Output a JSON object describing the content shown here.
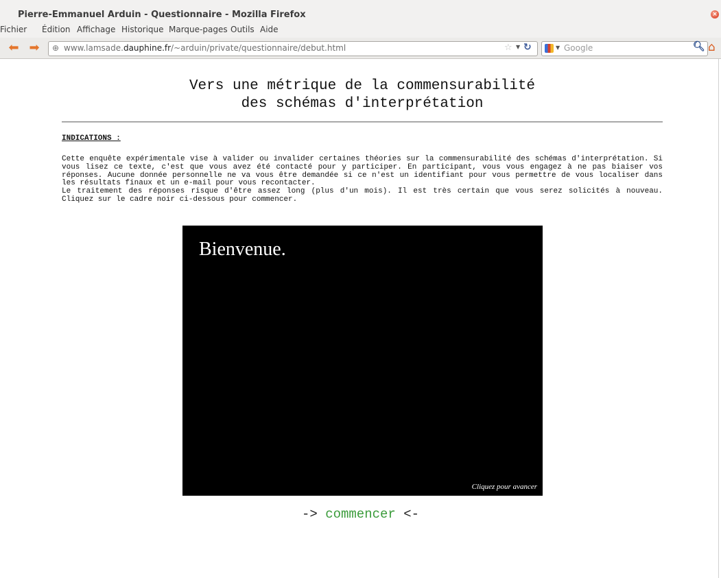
{
  "window": {
    "title": "Pierre-Emmanuel Arduin - Questionnaire - Mozilla Firefox"
  },
  "menu": [
    "Fichier",
    "Édition",
    "Affichage",
    "Historique",
    "Marque-pages",
    "Outils",
    "Aide"
  ],
  "navbar": {
    "url_prefix": "www.lamsade.",
    "url_domain": "dauphine.fr",
    "url_suffix": "/~arduin/private/questionnaire/debut.html",
    "search_engine": "Google"
  },
  "page": {
    "title_line1": "Vers une métrique de la commensurabilité",
    "title_line2": "des schémas d'interprétation",
    "indications_heading": "INDICATIONS :",
    "intro_paragraph1": "Cette enquête expérimentale vise à valider ou invalider certaines théories sur la commensurabilité des schémas d'interprétation. Si vous lisez ce texte, c'est que vous avez été contacté pour y participer. En participant, vous vous engagez à ne pas biaiser vos réponses. Aucune donnée personnelle ne va vous être demandée si ce n'est un identifiant pour vous permettre de vous localiser dans les résultats finaux et un e-mail pour vous recontacter.",
    "intro_paragraph2": "Le traitement des réponses risque d'être assez long (plus d'un mois). Il est très certain que vous serez solicités à nouveau. Cliquez sur le cadre noir ci-dessous pour commencer.",
    "frame_welcome": "Bienvenue.",
    "frame_advance": "Cliquez pour avancer",
    "start_prefix": "->",
    "start_link": "commencer",
    "start_suffix": "<-"
  },
  "colors": {
    "link_green": "#3a9b3a",
    "frame_black": "#000000",
    "firefox_orange": "#e4762c"
  }
}
